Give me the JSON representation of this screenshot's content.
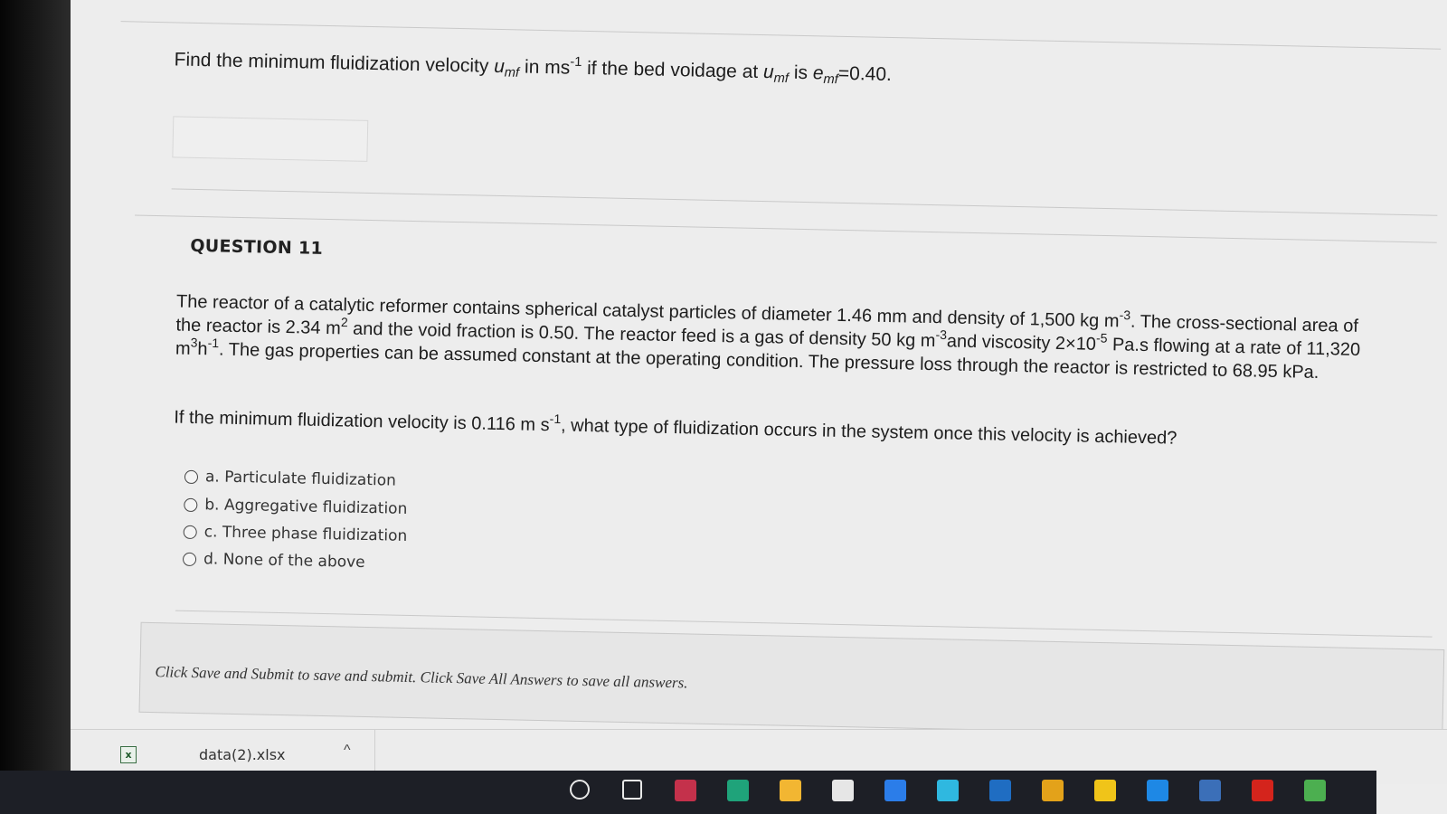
{
  "question10": {
    "text_a": "Find the minimum fluidization velocity ",
    "var_u": "u",
    "sub_mf": "mf",
    "text_b": " in ms",
    "sup_neg1": "-1",
    "text_c": " if the bed voidage at ",
    "text_d": " is ",
    "var_e": "e",
    "text_e": "=0.40."
  },
  "question11": {
    "heading": "QUESTION 11",
    "p1_a": "The reactor of a catalytic reformer contains spherical catalyst particles of diameter 1.46 mm and density of 1,500 kg m",
    "p1_sup1": "-3",
    "p1_b": ". The cross-sectional area of the reactor is 2.34 m",
    "p1_sup2": "2",
    "p1_c": " and the void fraction is 0.50. The reactor feed is a gas of density 50 kg m",
    "p1_sup3": "-3",
    "p1_d": "and viscosity 2×10",
    "p1_sup4": "-5",
    "p1_e": " Pa.s flowing at a rate of 11,320 m",
    "p1_sup5": "3",
    "p1_f": "h",
    "p1_sup6": "-1",
    "p1_g": ". The gas properties can be assumed constant at the operating condition. The pressure loss through the reactor is restricted to 68.95 kPa.",
    "p2_a": "If the minimum fluidization velocity is 0.116 m s",
    "p2_sup": "-1",
    "p2_b": ", what type of fluidization occurs in the system once this velocity is achieved?",
    "options": [
      "a. Particulate fluidization",
      "b. Aggregative fluidization",
      "c. Three phase fluidization",
      "d. None of the above"
    ]
  },
  "footer": {
    "note": "Click Save and Submit to save and submit. Click Save All Answers to save all answers."
  },
  "download_bar": {
    "file_name": "data(2).xlsx",
    "file_icon": "x",
    "chevron": "^"
  },
  "taskbar": {
    "icons": [
      "search-icon",
      "task-view-icon",
      "teams-icon",
      "edge-icon",
      "file-explorer-icon",
      "store-icon",
      "safari-icon",
      "windows-icon",
      "outlook-icon",
      "chrome-icon",
      "sticky-notes-icon",
      "onedrive-icon",
      "photos-icon",
      "acrobat-icon",
      "notification-app-icon"
    ],
    "colors": [
      "#e8e8e8",
      "#e8e8e8",
      "#c4314b",
      "#1fa37a",
      "#f2b632",
      "#e6e6e6",
      "#2b7de9",
      "#2fb8e0",
      "#1f6dc2",
      "#e3a21a",
      "#f0c419",
      "#1e88e5",
      "#3b6fb8",
      "#d4241c",
      "#4caf50"
    ]
  }
}
